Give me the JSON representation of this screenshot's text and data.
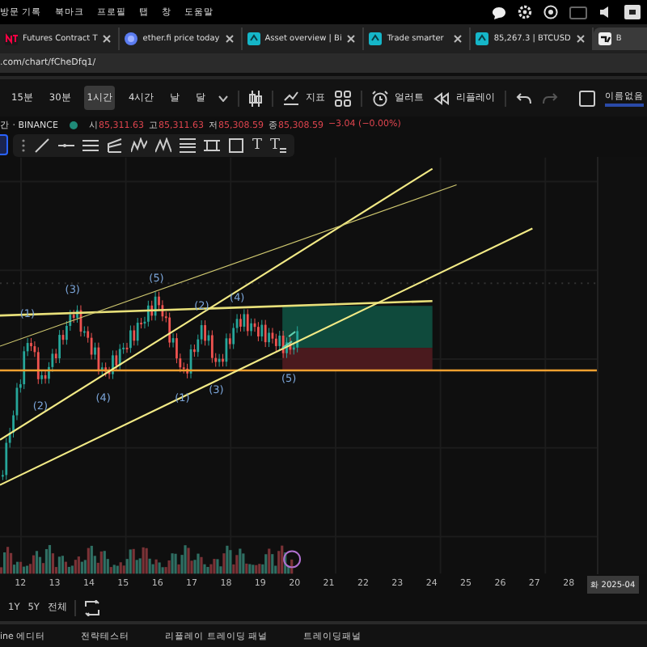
{
  "menu_bar": {
    "items": [
      "방문 기록",
      "북마크",
      "프로필",
      "탭",
      "창",
      "도움말"
    ]
  },
  "tabs": [
    {
      "label": "Futures Contract T",
      "selected": false,
      "kind": "nt"
    },
    {
      "label": "ether.fi price today",
      "selected": false,
      "kind": "globe"
    },
    {
      "label": "Asset overview | Bi",
      "selected": false,
      "kind": "tv"
    },
    {
      "label": "Trade smarter",
      "selected": false,
      "kind": "tv"
    },
    {
      "label": "85,267.3 | BTCUSD",
      "selected": false,
      "kind": "tv"
    },
    {
      "label": "B",
      "selected": true,
      "kind": "tvlogo"
    }
  ],
  "address": ".com/chart/fCheDfq1/",
  "intervals": [
    {
      "label": "15분",
      "selected": false
    },
    {
      "label": "30분",
      "selected": false
    },
    {
      "label": "1시간",
      "selected": true
    },
    {
      "label": "4시간",
      "selected": false
    },
    {
      "label": "날",
      "selected": false
    },
    {
      "label": "달",
      "selected": false
    }
  ],
  "toolbar": {
    "indicators": "지표",
    "alert": "얼러트",
    "replay": "리플레이",
    "layout_name": "이름없음"
  },
  "symbol": {
    "name": "간 · BINANCE",
    "ohlc": [
      {
        "label": "시",
        "value": "85,311.63"
      },
      {
        "label": "고",
        "value": "85,311.63"
      },
      {
        "label": "저",
        "value": "85,308.59"
      },
      {
        "label": "종",
        "value": "85,308.59"
      }
    ],
    "change": "−3.04 (−0.00%)"
  },
  "text_tools": [
    "T",
    "T"
  ],
  "wave_labels": [
    "(1)",
    "(2)",
    "(3)",
    "(4)",
    "(5)",
    "(1)",
    "(2)",
    "(3)",
    "(4)",
    "(5)"
  ],
  "x_axis": [
    "12",
    "13",
    "14",
    "15",
    "16",
    "17",
    "18",
    "19",
    "20",
    "21",
    "22",
    "23",
    "24",
    "25",
    "26",
    "27",
    "28"
  ],
  "date_badge": "화 2025-04",
  "ranges": [
    "1Y",
    "5Y",
    "전체"
  ],
  "bottom_tabs": [
    "ine 에디터",
    "전략테스터",
    "리플레이 트레이딩 패널",
    "트레이딩패널"
  ]
}
